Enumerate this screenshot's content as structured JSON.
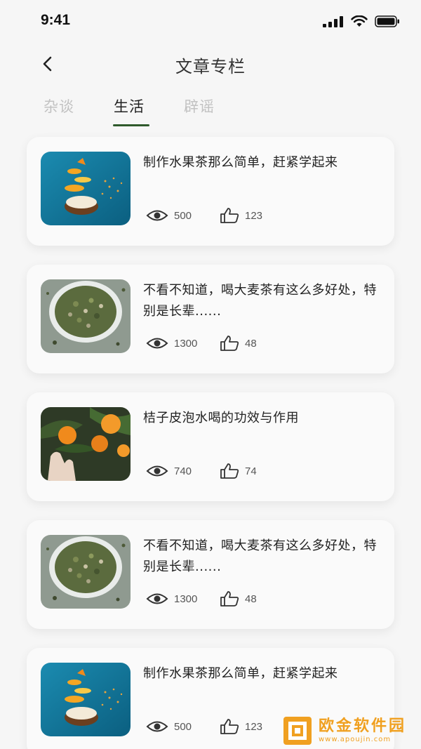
{
  "status_bar": {
    "time": "9:41"
  },
  "nav": {
    "title": "文章专栏"
  },
  "tabs": [
    {
      "label": "杂谈",
      "active": false
    },
    {
      "label": "生活",
      "active": true
    },
    {
      "label": "辟谣",
      "active": false
    }
  ],
  "articles": [
    {
      "title": "制作水果茶那么简单，赶紧学起来",
      "views": "500",
      "likes": "123",
      "image": "fruit-tea-image"
    },
    {
      "title": "不看不知道，喝大麦茶有这么多好处，特别是长辈......",
      "views": "1300",
      "likes": "48",
      "image": "barley-tea-image"
    },
    {
      "title": "桔子皮泡水喝的功效与作用",
      "views": "740",
      "likes": "74",
      "image": "orange-tree-image"
    },
    {
      "title": "不看不知道，喝大麦茶有这么多好处，特别是长辈......",
      "views": "1300",
      "likes": "48",
      "image": "barley-tea-image"
    },
    {
      "title": "制作水果茶那么简单，赶紧学起来",
      "views": "500",
      "likes": "123",
      "image": "fruit-tea-image"
    }
  ],
  "watermark": {
    "name": "欧金软件园",
    "url": "www.apoujin.com"
  },
  "colors": {
    "accent": "#2f5a2c",
    "background": "#f6f6f6",
    "card": "#fafafa",
    "watermark": "#f0a020"
  }
}
